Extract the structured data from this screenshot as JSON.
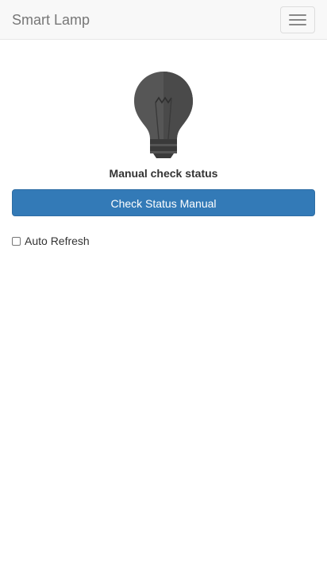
{
  "navbar": {
    "brand": "Smart Lamp",
    "toggle_icon": "hamburger-menu-icon"
  },
  "lamp": {
    "icon": "lightbulb-icon",
    "state": "off",
    "color": "#555555"
  },
  "status": {
    "label": "Manual check status"
  },
  "actions": {
    "check_status_label": "Check Status Manual"
  },
  "auto_refresh": {
    "label": "Auto Refresh",
    "checked": false
  },
  "colors": {
    "primary": "#337ab7",
    "navbar_bg": "#f8f8f8"
  }
}
